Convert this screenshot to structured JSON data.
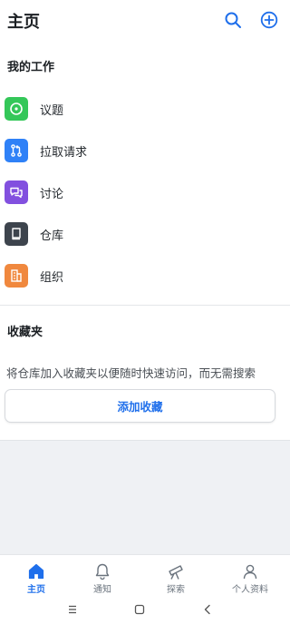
{
  "header": {
    "title": "主页"
  },
  "my_work": {
    "title": "我的工作",
    "items": [
      {
        "label": "议题",
        "icon": "issue-icon",
        "color": "#34c759"
      },
      {
        "label": "拉取请求",
        "icon": "pull-request-icon",
        "color": "#2f81f7"
      },
      {
        "label": "讨论",
        "icon": "discussion-icon",
        "color": "#8250df"
      },
      {
        "label": "仓库",
        "icon": "repository-icon",
        "color": "#3d444d"
      },
      {
        "label": "组织",
        "icon": "organization-icon",
        "color": "#f0883e"
      }
    ]
  },
  "favorites": {
    "title": "收藏夹",
    "description": "将仓库加入收藏夹以便随时快速访问，而无需搜索",
    "add_button": "添加收藏"
  },
  "tabbar": {
    "tabs": [
      {
        "label": "主页",
        "icon": "home-icon",
        "active": true
      },
      {
        "label": "通知",
        "icon": "bell-icon",
        "active": false
      },
      {
        "label": "探索",
        "icon": "telescope-icon",
        "active": false
      },
      {
        "label": "个人资料",
        "icon": "person-icon",
        "active": false
      }
    ]
  },
  "colors": {
    "accent": "#1f6feb"
  }
}
